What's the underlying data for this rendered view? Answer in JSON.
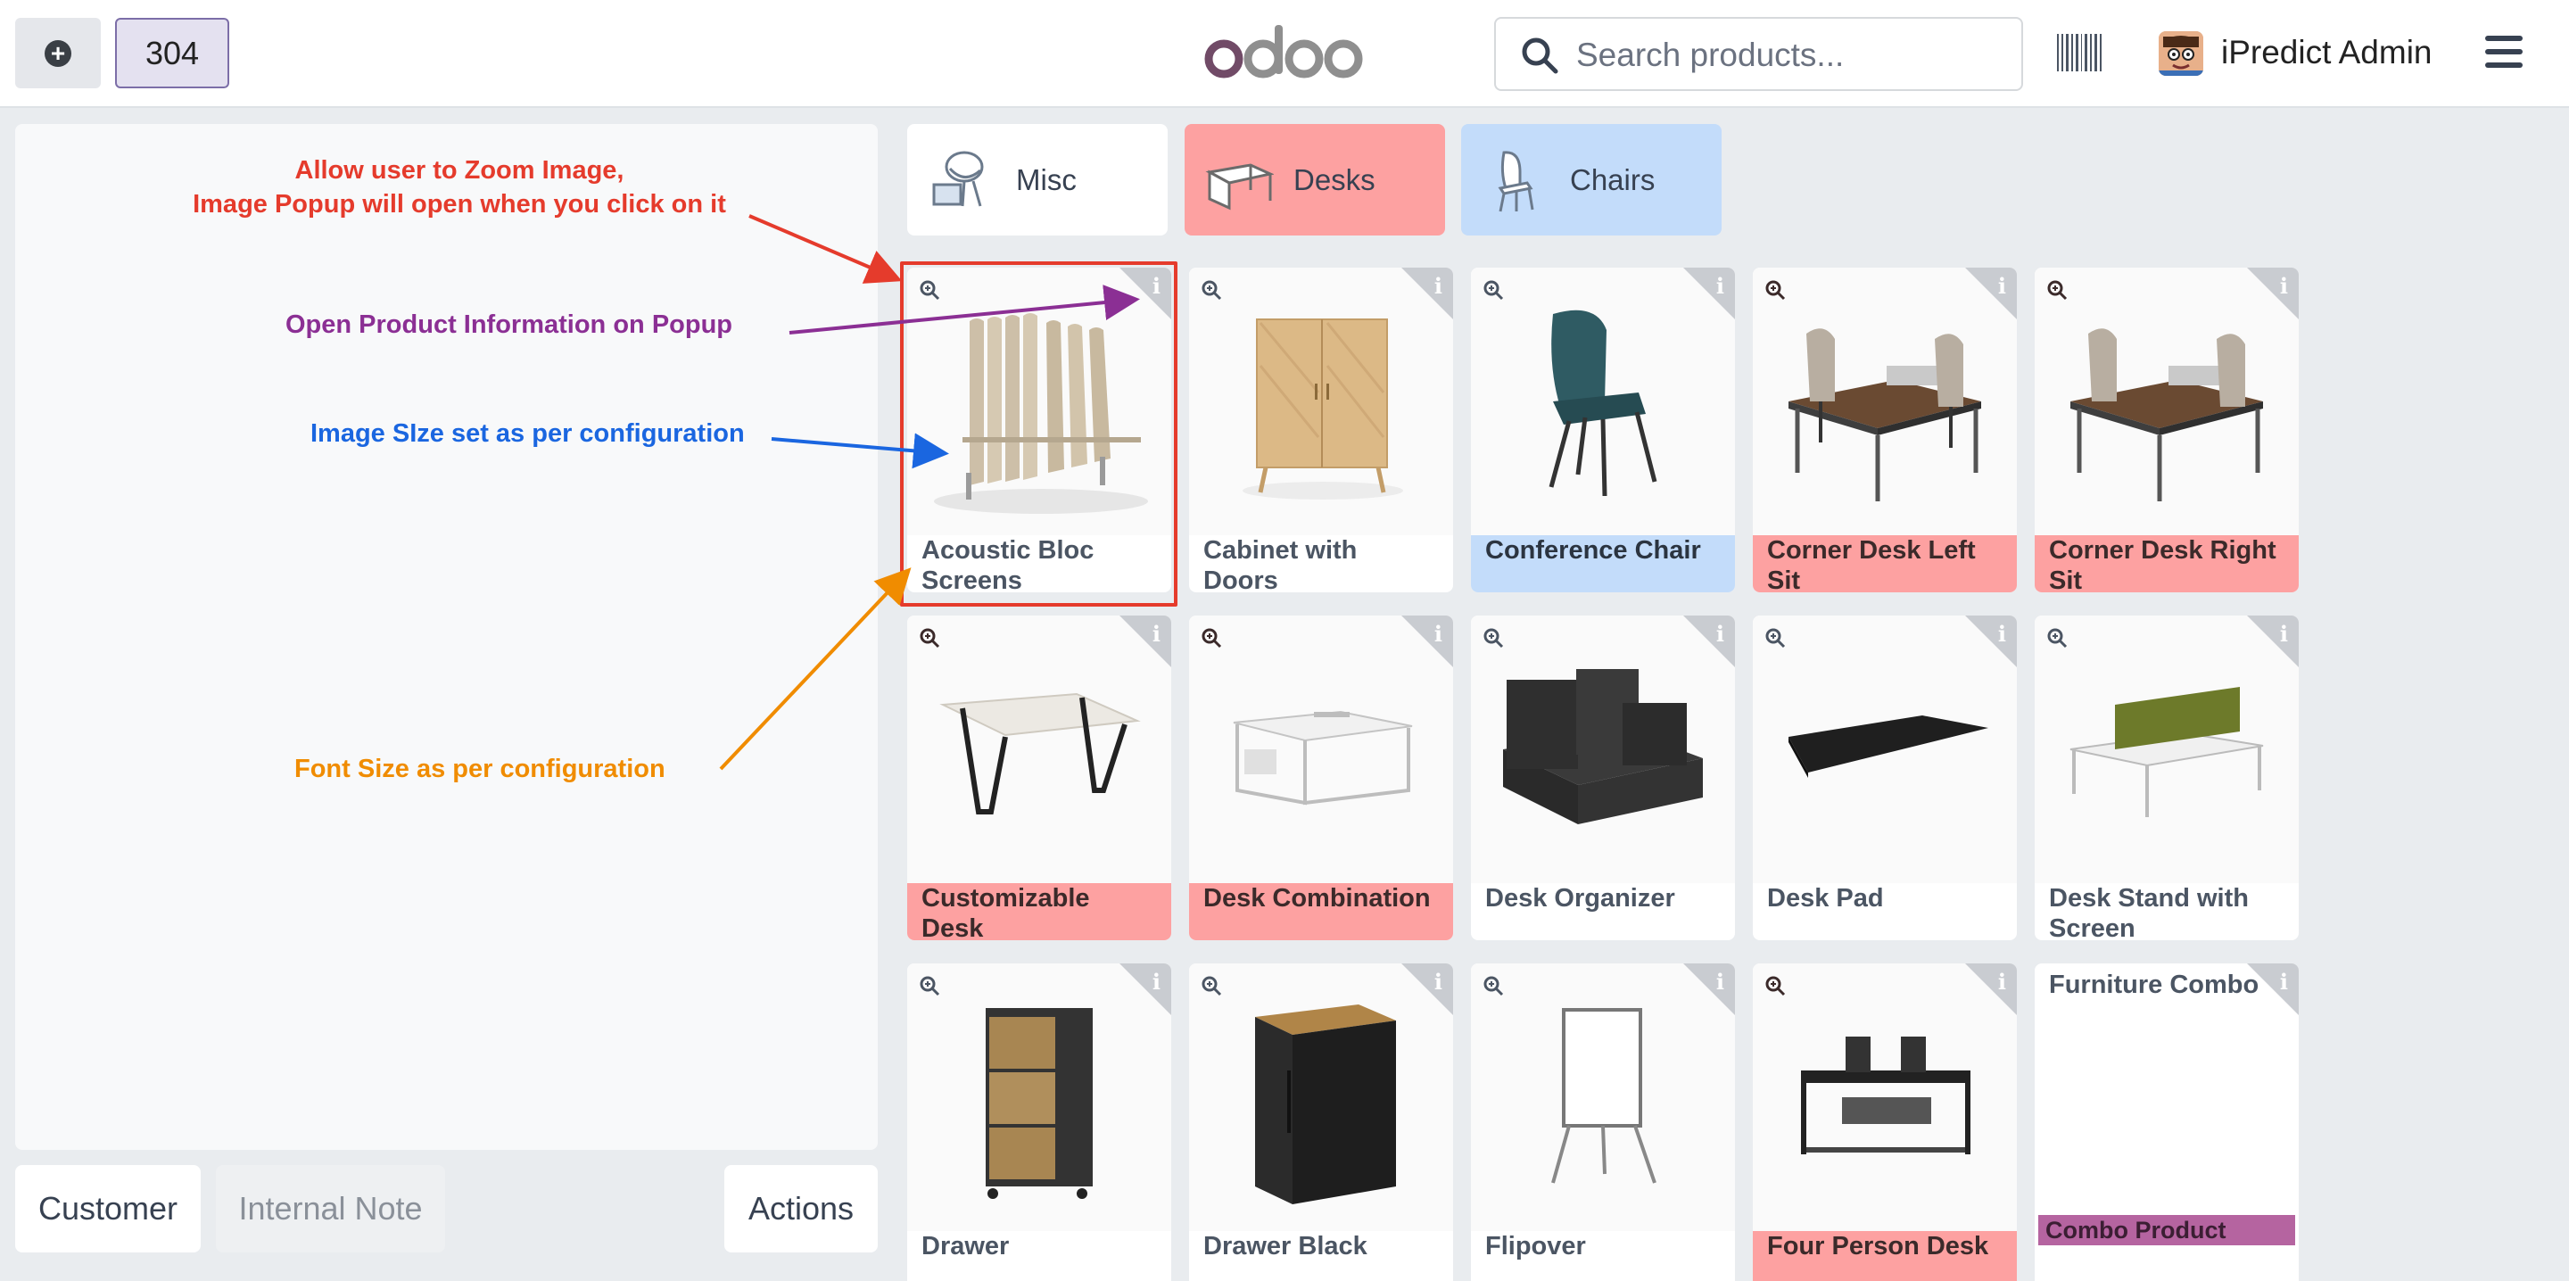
{
  "header": {
    "new_order_icon": "plus-circle-icon",
    "order_number": "304",
    "brand": "odoo",
    "search_placeholder": "Search products...",
    "barcode_icon": "barcode-icon",
    "user_name": "iPredict Admin",
    "menu_icon": "hamburger-icon"
  },
  "left_panel": {
    "buttons": {
      "customer": "Customer",
      "internal_note": "Internal Note",
      "actions": "Actions"
    }
  },
  "annotations": {
    "zoom_line1": "Allow user to Zoom Image,",
    "zoom_line2": "Image Popup will open when you click on it",
    "info": "Open Product Information on Popup",
    "image_size": "Image SIze set as per configuration",
    "font_size": "Font Size as per configuration"
  },
  "categories": [
    {
      "label": "Misc",
      "color": "#ffffff"
    },
    {
      "label": "Desks",
      "color": "#fda1a1"
    },
    {
      "label": "Chairs",
      "color": "#c3dcfa"
    }
  ],
  "products": [
    {
      "name": "Acoustic Bloc Screens",
      "category_color": "none"
    },
    {
      "name": "Cabinet with Doors",
      "category_color": "none"
    },
    {
      "name": "Conference Chair",
      "category_color": "blue"
    },
    {
      "name": "Corner Desk Left Sit",
      "category_color": "red"
    },
    {
      "name": "Corner Desk Right Sit",
      "category_color": "red"
    },
    {
      "name": "Customizable Desk",
      "category_color": "red"
    },
    {
      "name": "Desk Combination",
      "category_color": "red"
    },
    {
      "name": "Desk Organizer",
      "category_color": "none"
    },
    {
      "name": "Desk Pad",
      "category_color": "none"
    },
    {
      "name": "Desk Stand with Screen",
      "category_color": "none"
    },
    {
      "name": "Drawer",
      "category_color": "none"
    },
    {
      "name": "Drawer Black",
      "category_color": "none"
    },
    {
      "name": "Flipover",
      "category_color": "none"
    },
    {
      "name": "Four Person Desk",
      "category_color": "red"
    },
    {
      "name": "Furniture Combo",
      "category_color": "none",
      "tag": "Combo Product"
    }
  ],
  "colors": {
    "accent_red": "#e53b2c",
    "accent_purple": "#8b2f94",
    "accent_blue": "#1a66e0",
    "accent_orange": "#f08c00",
    "desks_pink": "#fda1a1",
    "chairs_blue": "#c3dcfa",
    "combo_purple": "#b564a0"
  }
}
